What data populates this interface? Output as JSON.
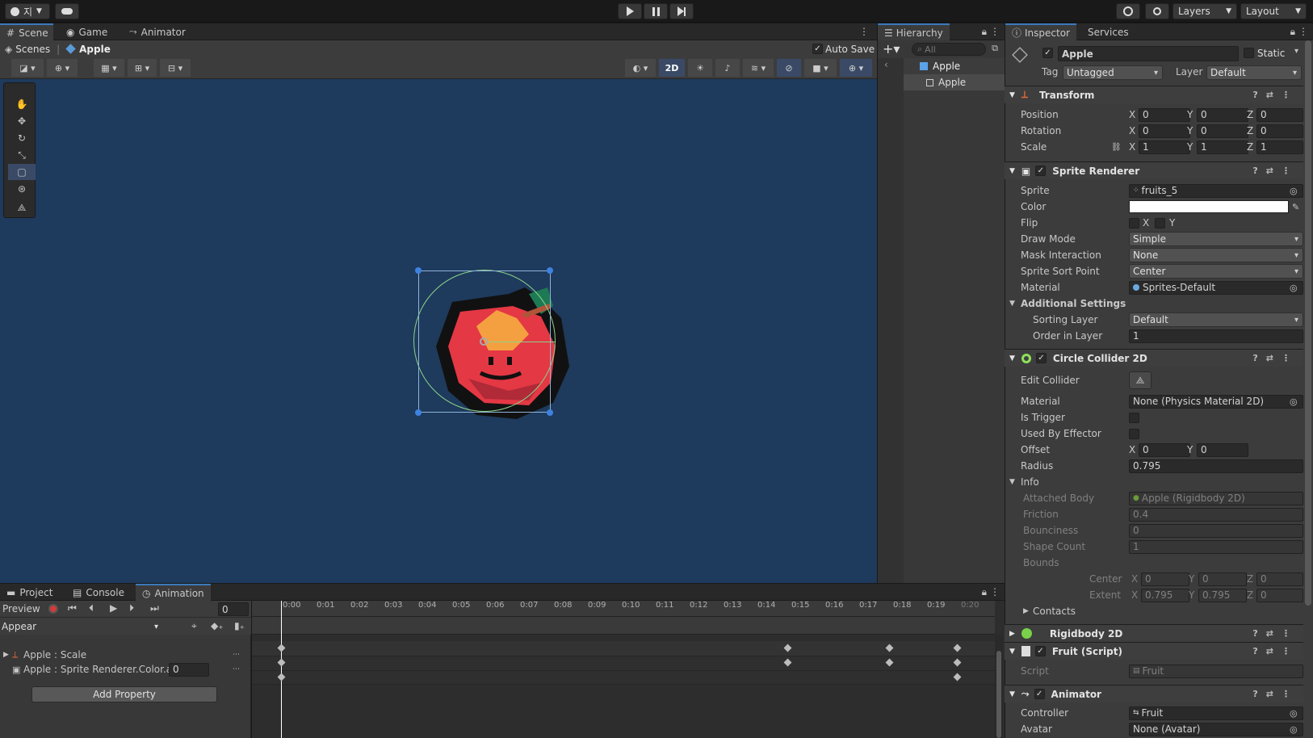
{
  "toolbar": {
    "account_label": "지",
    "layers_label": "Layers",
    "layout_label": "Layout"
  },
  "scene_panel": {
    "tabs": [
      {
        "label": "Scene"
      },
      {
        "label": "Game"
      },
      {
        "label": "Animator"
      }
    ],
    "breadcrumb_root": "Scenes",
    "breadcrumb_current": "Apple",
    "auto_save_label": "Auto Save",
    "mode_2d_label": "2D",
    "bg_color": "#1e3a5c"
  },
  "hierarchy": {
    "tab_label": "Hierarchy",
    "search_placeholder": "All",
    "root_label": "Apple",
    "child_label": "Apple"
  },
  "inspector": {
    "tabs": [
      {
        "label": "Inspector"
      },
      {
        "label": "Services"
      }
    ],
    "object_name": "Apple",
    "static_label": "Static",
    "tag_label": "Tag",
    "tag_value": "Untagged",
    "layer_label": "Layer",
    "layer_value": "Default",
    "transform": {
      "title": "Transform",
      "position_label": "Position",
      "rotation_label": "Rotation",
      "scale_label": "Scale",
      "position": {
        "x": "0",
        "y": "0",
        "z": "0"
      },
      "rotation": {
        "x": "0",
        "y": "0",
        "z": "0"
      },
      "scale": {
        "x": "1",
        "y": "1",
        "z": "1"
      }
    },
    "sprite_renderer": {
      "title": "Sprite Renderer",
      "sprite_label": "Sprite",
      "sprite_value": "fruits_5",
      "color_label": "Color",
      "flip_label": "Flip",
      "flip_x": "X",
      "flip_y": "Y",
      "draw_mode_label": "Draw Mode",
      "draw_mode_value": "Simple",
      "mask_label": "Mask Interaction",
      "mask_value": "None",
      "sort_point_label": "Sprite Sort Point",
      "sort_point_value": "Center",
      "material_label": "Material",
      "material_value": "Sprites-Default",
      "additional_label": "Additional Settings",
      "sorting_layer_label": "Sorting Layer",
      "sorting_layer_value": "Default",
      "order_label": "Order in Layer",
      "order_value": "1"
    },
    "circle_collider": {
      "title": "Circle Collider 2D",
      "edit_label": "Edit Collider",
      "material_label": "Material",
      "material_value": "None (Physics Material 2D)",
      "trigger_label": "Is Trigger",
      "effector_label": "Used By Effector",
      "offset_label": "Offset",
      "offset": {
        "x": "0",
        "y": "0"
      },
      "radius_label": "Radius",
      "radius_value": "0.795",
      "info_label": "Info",
      "attached_label": "Attached Body",
      "attached_value": "Apple (Rigidbody 2D)",
      "friction_label": "Friction",
      "friction_value": "0.4",
      "bounciness_label": "Bounciness",
      "bounciness_value": "0",
      "shape_count_label": "Shape Count",
      "shape_count_value": "1",
      "bounds_label": "Bounds",
      "center_label": "Center",
      "center": {
        "x": "0",
        "y": "0",
        "z": "0"
      },
      "extent_label": "Extent",
      "extent": {
        "x": "0.795",
        "y": "0.795",
        "z": "0"
      },
      "contacts_label": "Contacts"
    },
    "rigidbody": {
      "title": "Rigidbody 2D"
    },
    "fruit_script": {
      "title": "Fruit (Script)",
      "script_label": "Script",
      "script_value": "Fruit"
    },
    "animator": {
      "title": "Animator",
      "controller_label": "Controller",
      "controller_value": "Fruit",
      "avatar_label": "Avatar",
      "avatar_value": "None (Avatar)"
    },
    "axis": {
      "x": "X",
      "y": "Y",
      "z": "Z"
    }
  },
  "animation_panel": {
    "tabs": [
      {
        "label": "Project"
      },
      {
        "label": "Console"
      },
      {
        "label": "Animation"
      }
    ],
    "preview_label": "Preview",
    "frame_value": "0",
    "clip_value": "Appear",
    "properties": [
      {
        "label": "Apple : Scale"
      },
      {
        "label": "Apple : Sprite Renderer.Color.a",
        "value": "0"
      }
    ],
    "add_property_label": "Add Property",
    "ruler": [
      "0:00",
      "0:01",
      "0:02",
      "0:03",
      "0:04",
      "0:05",
      "0:06",
      "0:07",
      "0:08",
      "0:09",
      "0:10",
      "0:11",
      "0:12",
      "0:13",
      "0:14",
      "0:15",
      "0:16",
      "0:17",
      "0:18",
      "0:19",
      "0:20"
    ]
  }
}
